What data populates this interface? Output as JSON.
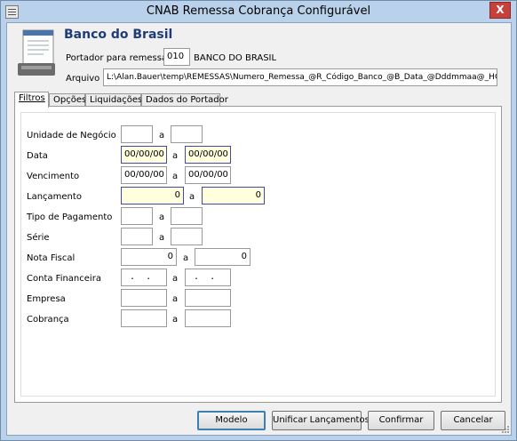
{
  "window": {
    "title": "CNAB Remessa Cobrança Configurável",
    "close": "X"
  },
  "header": {
    "bank_name": "Banco do Brasil",
    "portador_label": "Portador para remessa",
    "portador_code": "010",
    "portador_name": "BANCO DO BRASIL",
    "arquivo_label": "Arquivo",
    "arquivo_path": "L:\\Alan.Bauer\\temp\\REMESSAS\\Numero_Remessa_@R_Código_Banco_@B_Data_@Dddmmaa@_HOR"
  },
  "tabs": [
    "Filtros",
    "Opções",
    "Liquidações",
    "Dados do Portador"
  ],
  "filters": {
    "separator": "a",
    "unidade_label": "Unidade de Negócio",
    "data_label": "Data",
    "data_from": "00/00/00",
    "data_to": "00/00/00",
    "vencimento_label": "Vencimento",
    "vencimento_from": "00/00/00",
    "vencimento_to": "00/00/00",
    "lancamento_label": "Lançamento",
    "lancamento_from": "0",
    "lancamento_to": "0",
    "tipo_pagamento_label": "Tipo de Pagamento",
    "serie_label": "Série",
    "nota_fiscal_label": "Nota Fiscal",
    "nota_fiscal_from": "0",
    "nota_fiscal_to": "0",
    "conta_financeira_label": "Conta Financeira",
    "conta_from": " .  .",
    "conta_to": " .  .",
    "empresa_label": "Empresa",
    "cobranca_label": "Cobrança"
  },
  "buttons": {
    "modelo": "Modelo",
    "unificar": "Unificar Lançamentos",
    "confirmar": "Confirmar",
    "cancelar": "Cancelar"
  },
  "colors": {
    "title_bg": "#b9d1ea",
    "bank_name": "#1f3c78",
    "highlight_field": "#ffffdd",
    "close_button": "#c7403a"
  }
}
